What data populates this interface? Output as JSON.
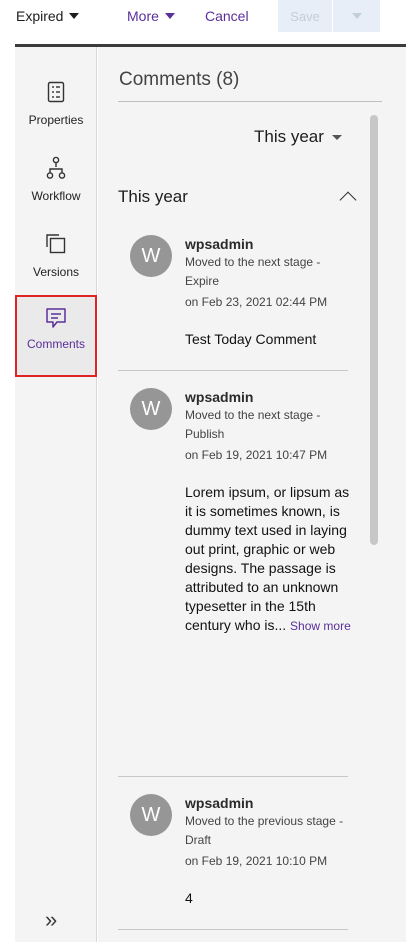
{
  "toolbar": {
    "status_label": "Expired",
    "more_label": "More",
    "cancel_label": "Cancel",
    "save_label": "Save"
  },
  "rail": {
    "items": [
      {
        "label": "Properties",
        "icon": "properties-icon"
      },
      {
        "label": "Workflow",
        "icon": "workflow-icon"
      },
      {
        "label": "Versions",
        "icon": "versions-icon"
      },
      {
        "label": "Comments",
        "icon": "comments-icon",
        "active": true
      }
    ],
    "expand_glyph": "»"
  },
  "panel": {
    "title": "Comments (8)",
    "filter_label": "This year",
    "group_label": "This year"
  },
  "comments": [
    {
      "avatar": "W",
      "user": "wpsadmin",
      "action": "Moved to the next stage - Expire",
      "date": "on Feb 23, 2021 02:44 PM",
      "text": "Test Today Comment"
    },
    {
      "avatar": "W",
      "user": "wpsadmin",
      "action": "Moved to the next stage - Publish",
      "date": "on Feb 19, 2021 10:47 PM",
      "text": "Lorem ipsum, or lipsum as it is sometimes known, is dummy text used in laying out print, graphic or web designs. The passage is attributed to an unknown typesetter in the 15th century who is...",
      "show_more": "Show more"
    },
    {
      "avatar": "W",
      "user": "wpsadmin",
      "action": "Moved to the previous stage - Draft",
      "date": "on Feb 19, 2021 10:10 PM",
      "text": "4"
    }
  ],
  "colors": {
    "accent": "#5a2f9a",
    "highlight_border": "#e02424",
    "rail_bg": "#f4f4f4",
    "avatar_bg": "#969696"
  }
}
